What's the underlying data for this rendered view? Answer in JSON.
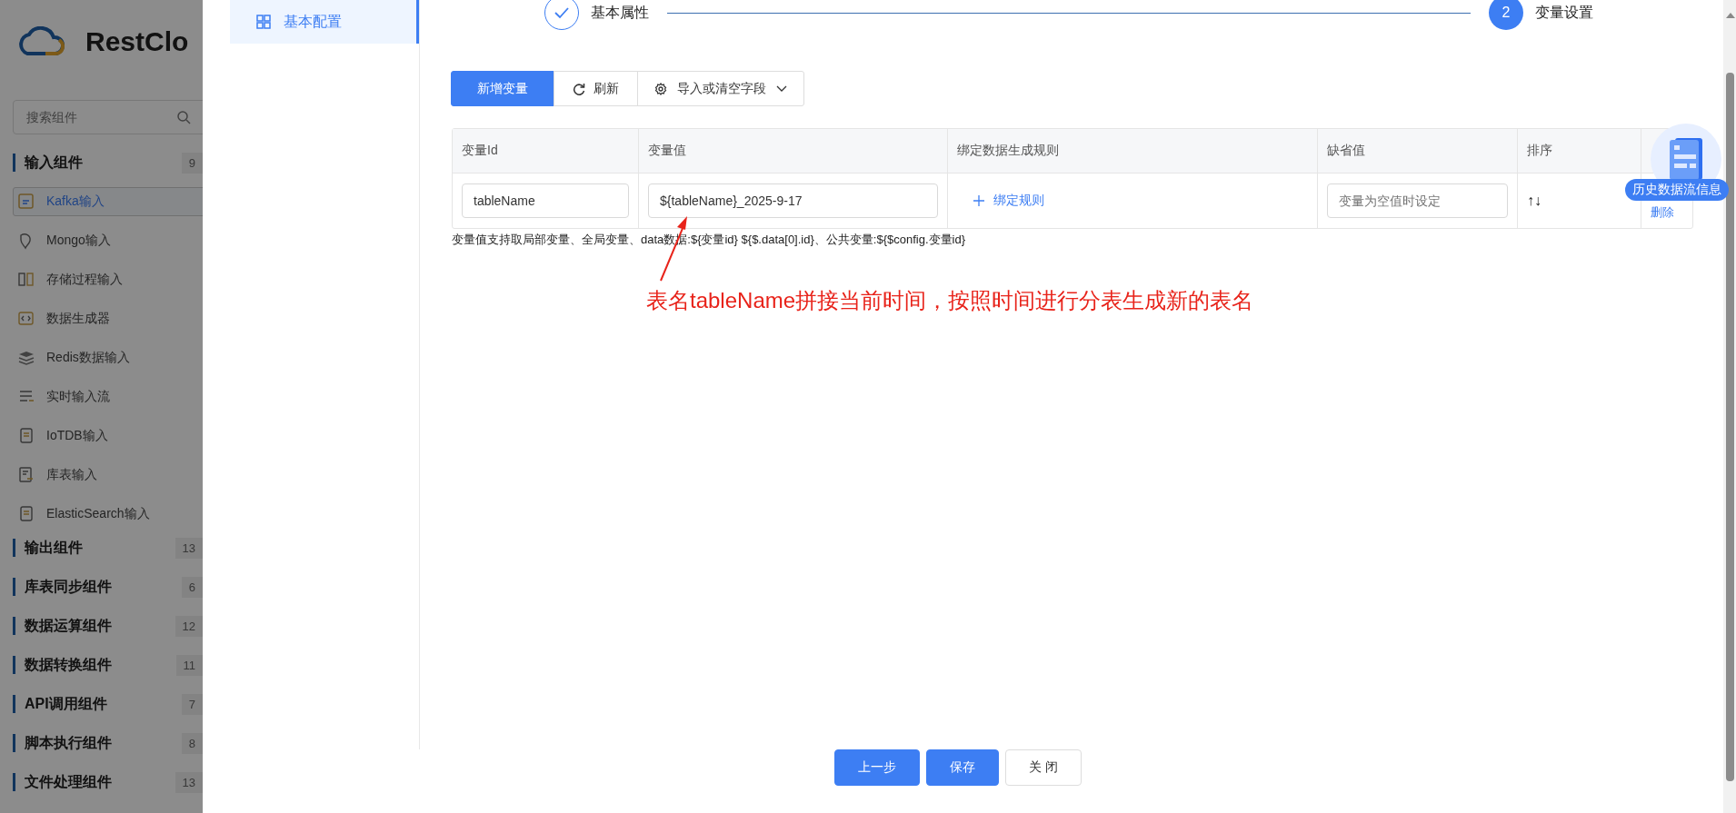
{
  "sidebar": {
    "logo": "RestClo",
    "search": {
      "placeholder": "搜索组件"
    },
    "groups": [
      {
        "label": "输入组件",
        "count": "9",
        "items": [
          {
            "label": "Kafka输入",
            "selected": true
          },
          {
            "label": "Mongo输入",
            "selected": false
          },
          {
            "label": "存储过程输入",
            "selected": false
          },
          {
            "label": "数据生成器",
            "selected": false
          },
          {
            "label": "Redis数据输入",
            "selected": false
          },
          {
            "label": "实时输入流",
            "selected": false
          },
          {
            "label": "IoTDB输入",
            "selected": false
          },
          {
            "label": "库表输入",
            "selected": false
          },
          {
            "label": "ElasticSearch输入",
            "selected": false
          }
        ]
      },
      {
        "label": "输出组件",
        "count": "13"
      },
      {
        "label": "库表同步组件",
        "count": "6"
      },
      {
        "label": "数据运算组件",
        "count": "12"
      },
      {
        "label": "数据转换组件",
        "count": "11"
      },
      {
        "label": "API调用组件",
        "count": "7"
      },
      {
        "label": "脚本执行组件",
        "count": "8"
      },
      {
        "label": "文件处理组件",
        "count": "13"
      }
    ]
  },
  "dialog": {
    "nav": [
      {
        "label": "基本配置",
        "selected": true
      }
    ],
    "steps": [
      {
        "kind": "done",
        "label": "基本属性"
      },
      {
        "kind": "current",
        "number": "2",
        "label": "变量设置"
      }
    ],
    "toolbar": [
      {
        "kind": "primary",
        "label": "新增变量"
      },
      {
        "kind": "refresh",
        "label": "刷新"
      },
      {
        "kind": "dropdown",
        "label": "导入或清空字段"
      }
    ],
    "table": {
      "columns": [
        "变量Id",
        "变量值",
        "绑定数据生成规则",
        "缺省值",
        "排序"
      ],
      "rows": [
        {
          "variable_id": "tableName",
          "variable_value": "${tableName}_2025-9-17",
          "bind_rule": "绑定规则",
          "default_placeholder": "变量为空值时设定",
          "sort": "↑↓",
          "action": "删除"
        }
      ]
    },
    "hint": "变量值支持取局部变量、全局变量、data数据:${变量id} ${$.data[0].id}、公共变量:${$config.变量id}",
    "annotation": "表名tableName拼接当前时间，按照时间进行分表生成新的表名",
    "floating_badge": "历史数据流信息",
    "footer": [
      {
        "kind": "primary",
        "label": "上一步"
      },
      {
        "kind": "primary",
        "label": "保存"
      },
      {
        "kind": "default",
        "label": "关 闭"
      }
    ]
  }
}
